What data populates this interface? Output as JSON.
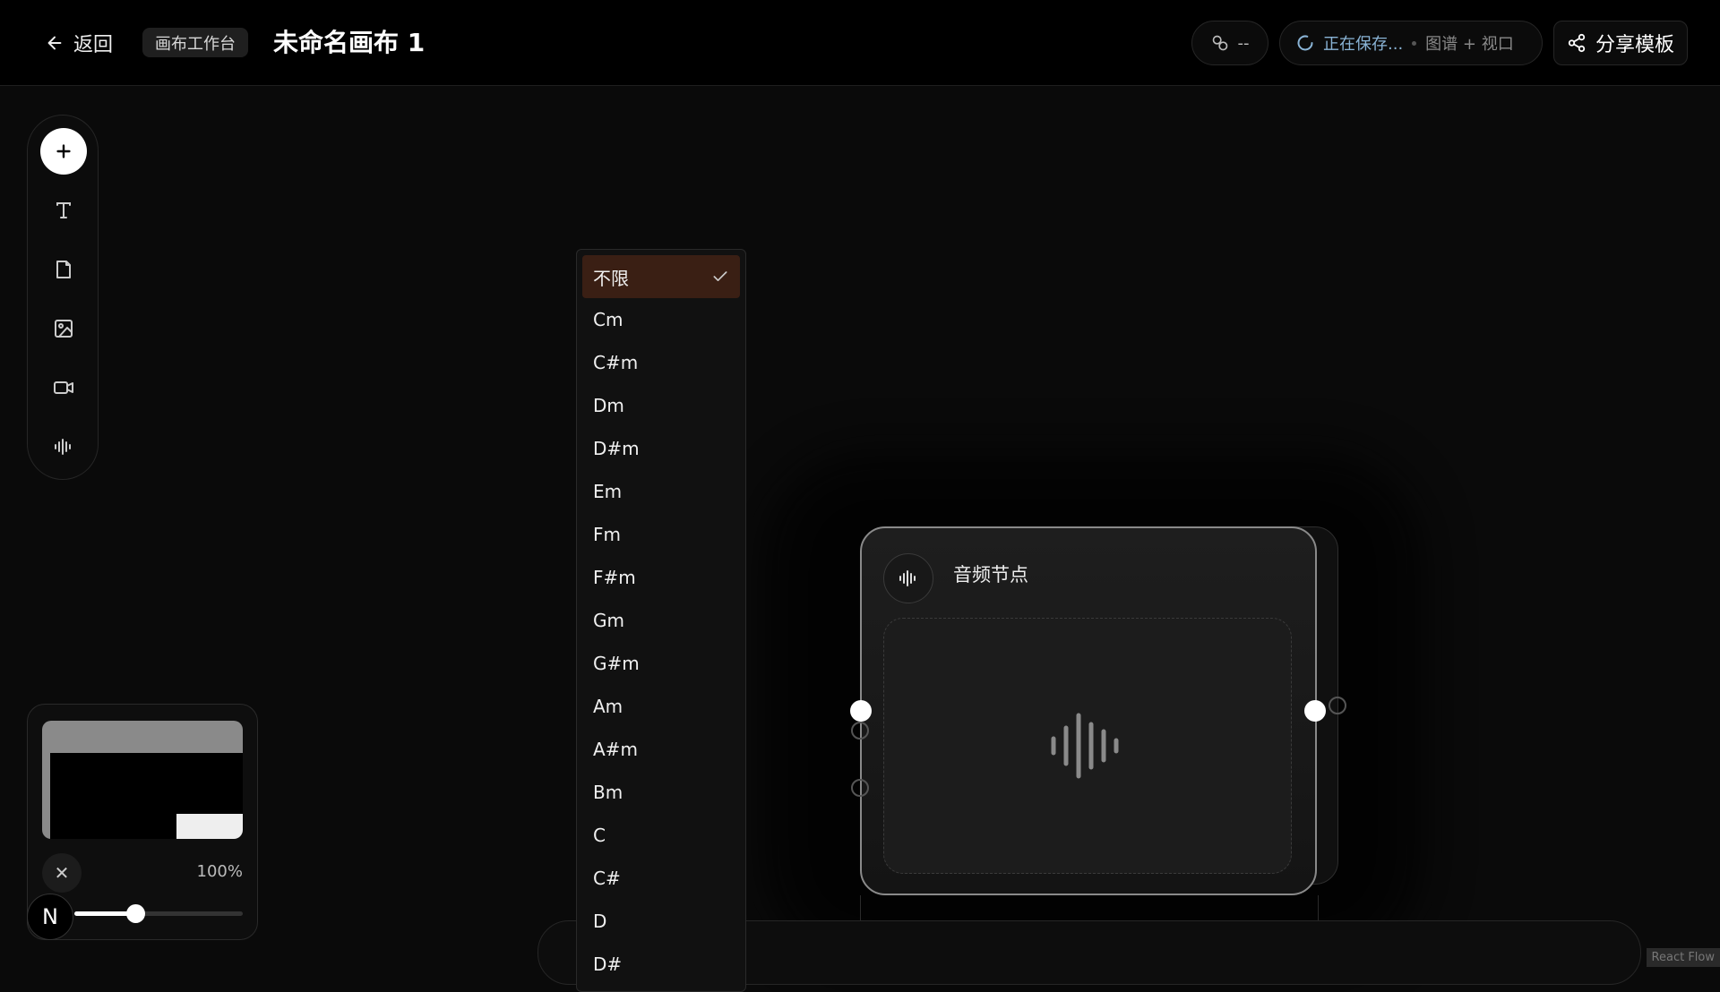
{
  "header": {
    "back_label": "返回",
    "workspace_chip": "画布工作台",
    "title": "未命名画布 1",
    "link_status": "--",
    "save_status": "正在保存...",
    "save_scope": "图谱 + 视口",
    "share_label": "分享模板"
  },
  "toolbar": {
    "tools": [
      "plus-icon",
      "text-icon",
      "document-icon",
      "image-icon",
      "video-icon",
      "audio-wave-icon"
    ]
  },
  "minimap": {
    "zoom_label": "100%",
    "close_glyph": "✕",
    "zoom_fraction": 0.36
  },
  "badge": {
    "letter": "N"
  },
  "node": {
    "title": "音频节点",
    "icon": "audio-wave-icon"
  },
  "dropdown": {
    "selected": "不限",
    "options": [
      "不限",
      "Cm",
      "C#m",
      "Dm",
      "D#m",
      "Em",
      "Fm",
      "F#m",
      "Gm",
      "G#m",
      "Am",
      "A#m",
      "Bm",
      "C",
      "C#",
      "D",
      "D#"
    ]
  },
  "attribution": "React Flow",
  "colors": {
    "background": "#0a0a0a",
    "selected_option": "#3a1f14",
    "save_status": "#8ab4d6"
  }
}
